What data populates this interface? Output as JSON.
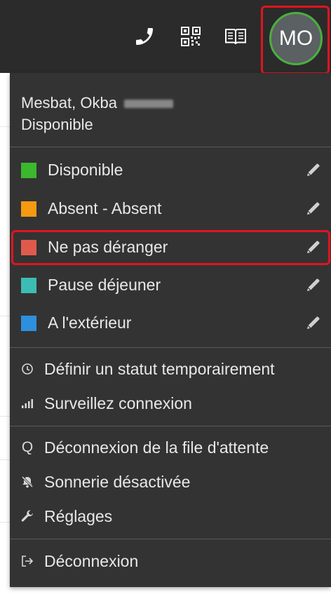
{
  "topbar": {
    "phone_icon": "phone-icon",
    "qr_icon": "qr-code-icon",
    "book_icon": "book-icon",
    "avatar_initials": "MO"
  },
  "user": {
    "name": "Mesbat, Okba",
    "status": "Disponible"
  },
  "statuses": [
    {
      "label": "Disponible",
      "color": "#3cb82e",
      "edit_icon": "pencil-icon"
    },
    {
      "label": "Absent - Absent",
      "color": "#f59a12",
      "edit_icon": "pencil-icon"
    },
    {
      "label": "Ne pas déranger",
      "color": "#e05a4c",
      "edit_icon": "pencil-icon",
      "highlighted": true
    },
    {
      "label": "Pause déjeuner",
      "color": "#3bbdb5",
      "edit_icon": "pencil-icon"
    },
    {
      "label": "A l'extérieur",
      "color": "#2e8fdc",
      "edit_icon": "pencil-icon"
    }
  ],
  "menu": {
    "temp_status": {
      "icon": "clock-icon",
      "label": "Définir un statut temporairement"
    },
    "monitor": {
      "icon": "signal-icon",
      "label": "Surveillez connexion"
    },
    "queue_logout": {
      "icon": "q-icon",
      "label": "Déconnexion de la file d'attente"
    },
    "ringer": {
      "icon": "bell-off-icon",
      "label": "Sonnerie désactivée"
    },
    "settings": {
      "icon": "wrench-icon",
      "label": "Réglages"
    },
    "logout": {
      "icon": "logout-icon",
      "label": "Déconnexion"
    }
  },
  "colors": {
    "topbar": "#2b2b2b",
    "panel": "#333333",
    "highlight_border": "#e0141e",
    "avatar_ring": "#4caf3e"
  }
}
